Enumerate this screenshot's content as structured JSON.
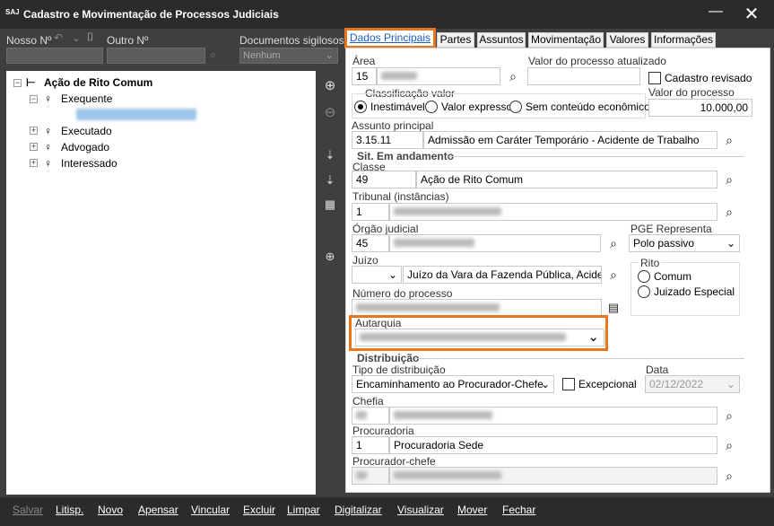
{
  "window": {
    "logo": "SAJ",
    "title": "Cadastro e Movimentação de Processos Judiciais",
    "minimize": "—",
    "close": "✕"
  },
  "top": {
    "nosso_label": "Nosso Nº",
    "outro_label": "Outro Nº",
    "docs_label": "Documentos sigilosos",
    "docs_value": "Nenhum"
  },
  "tree": {
    "root": "Ação de Rito Comum",
    "items": [
      "Exequente",
      "Executado",
      "Advogado",
      "Interessado"
    ]
  },
  "tabs": [
    "Dados Principais",
    "Partes",
    "Assuntos",
    "Movimentação",
    "Valores",
    "Informações"
  ],
  "form": {
    "area_label": "Área",
    "area_code": "15",
    "valor_atualizado_label": "Valor do processo atualizado",
    "cadastro_revisado": "Cadastro revisado",
    "classificacao_label": "Classificação valor",
    "opt_inestimavel": "Inestimável",
    "opt_expresso": "Valor expresso",
    "opt_sem": "Sem conteúdo econômico",
    "valor_processo_label": "Valor do processo",
    "valor_processo": "10.000,00",
    "assunto_label": "Assunto principal",
    "assunto_code": "3.15.11",
    "assunto_desc": "Admissão em Caráter Temporário - Acidente de Trabalho",
    "sit_label": "Sit. Em andamento",
    "classe_label": "Classe",
    "classe_code": "49",
    "classe_desc": "Ação de Rito Comum",
    "tribunal_label": "Tribunal (instâncias)",
    "tribunal_code": "1",
    "orgao_label": "Órgão judicial",
    "orgao_code": "45",
    "pge_label": "PGE Representa",
    "pge_value": "Polo passivo",
    "juizo_label": "Juízo",
    "juizo_desc": "Juízo da Vara da Fazenda Pública, Acidentes",
    "rito_label": "Rito",
    "rito_comum": "Comum",
    "rito_juizado": "Juizado Especial",
    "numero_label": "Número do processo",
    "autarquia_label": "Autarquia",
    "distribuicao_label": "Distribuição",
    "tipo_dist_label": "Tipo de distribuição",
    "tipo_dist_value": "Encaminhamento ao Procurador-Chefe",
    "excepcional": "Excepcional",
    "data_label": "Data",
    "data_value": "02/12/2022",
    "chefia_label": "Chefia",
    "procuradoria_label": "Procuradoria",
    "procuradoria_code": "1",
    "procuradoria_desc": "Procuradoria Sede",
    "procurador_chefe_label": "Procurador-chefe"
  },
  "bottom": [
    "Salvar",
    "Litisp.",
    "Novo",
    "Apensar",
    "Vincular",
    "Excluir",
    "Limpar",
    "Digitalizar",
    "Visualizar",
    "Mover",
    "Fechar"
  ],
  "colors": {
    "accent": "#e8761e",
    "link": "#1f5fbf"
  }
}
